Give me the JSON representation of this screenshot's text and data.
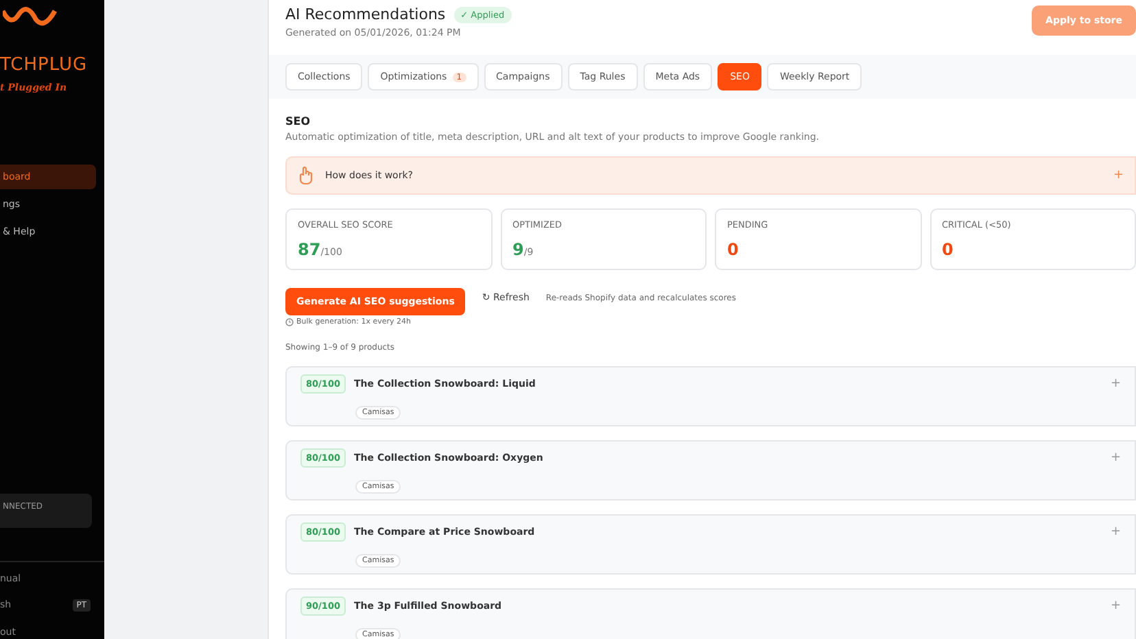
{
  "sidebar": {
    "brand": "TCHPLUG",
    "tagline": "t Plugged In",
    "nav": [
      {
        "label": "board",
        "selected": true
      },
      {
        "label": "ngs",
        "selected": false
      },
      {
        "label": "& Help",
        "selected": false
      }
    ],
    "status": "NNECTED",
    "footer": [
      {
        "label": "nual"
      },
      {
        "label": "sh",
        "badge": "PT"
      },
      {
        "label": "out"
      }
    ]
  },
  "header": {
    "title": "AI Recommendations",
    "badge": "✓ Applied",
    "subtitle": "Generated on 05/01/2026, 01:24 PM",
    "apply_button": "Apply to store"
  },
  "tabs": [
    {
      "label": "Collections",
      "selected": false
    },
    {
      "label": "Optimizations",
      "selected": false,
      "count": "1"
    },
    {
      "label": "Campaigns",
      "selected": false
    },
    {
      "label": "Tag Rules",
      "selected": false
    },
    {
      "label": "Meta Ads",
      "selected": false
    },
    {
      "label": "SEO",
      "selected": true
    },
    {
      "label": "Weekly Report",
      "selected": false
    }
  ],
  "section": {
    "title": "SEO",
    "description": "Automatic optimization of title, meta description, URL and alt text of your products to improve Google ranking.",
    "info": "How does it work?",
    "expand": "+"
  },
  "stats": [
    {
      "label": "OVERALL SEO SCORE",
      "value": "87",
      "suffix": "/100",
      "color": "#2f9e55"
    },
    {
      "label": "OPTIMIZED",
      "value": "9",
      "suffix": "/9",
      "color": "#2f9e55"
    },
    {
      "label": "PENDING",
      "value": "0",
      "color": "#f04a12"
    },
    {
      "label": "CRITICAL (<50)",
      "value": "0",
      "color": "#f04a12"
    }
  ],
  "actions": {
    "generate": "Generate AI SEO suggestions",
    "limit": "Bulk generation: 1x every 24h",
    "refresh": "↻ Refresh",
    "refresh_note": "Re-reads Shopify data and recalculates scores"
  },
  "showing": "Showing 1–9 of 9 products",
  "products": [
    {
      "score": "80/100",
      "name": "The Collection Snowboard: Liquid",
      "tag": "Camisas",
      "expand": "+"
    },
    {
      "score": "80/100",
      "name": "The Collection Snowboard: Oxygen",
      "tag": "Camisas",
      "expand": "+"
    },
    {
      "score": "80/100",
      "name": "The Compare at Price Snowboard",
      "tag": "Camisas",
      "expand": "+"
    },
    {
      "score": "90/100",
      "name": "The 3p Fulfilled Snowboard",
      "tag": "Camisas",
      "expand": "+"
    }
  ]
}
